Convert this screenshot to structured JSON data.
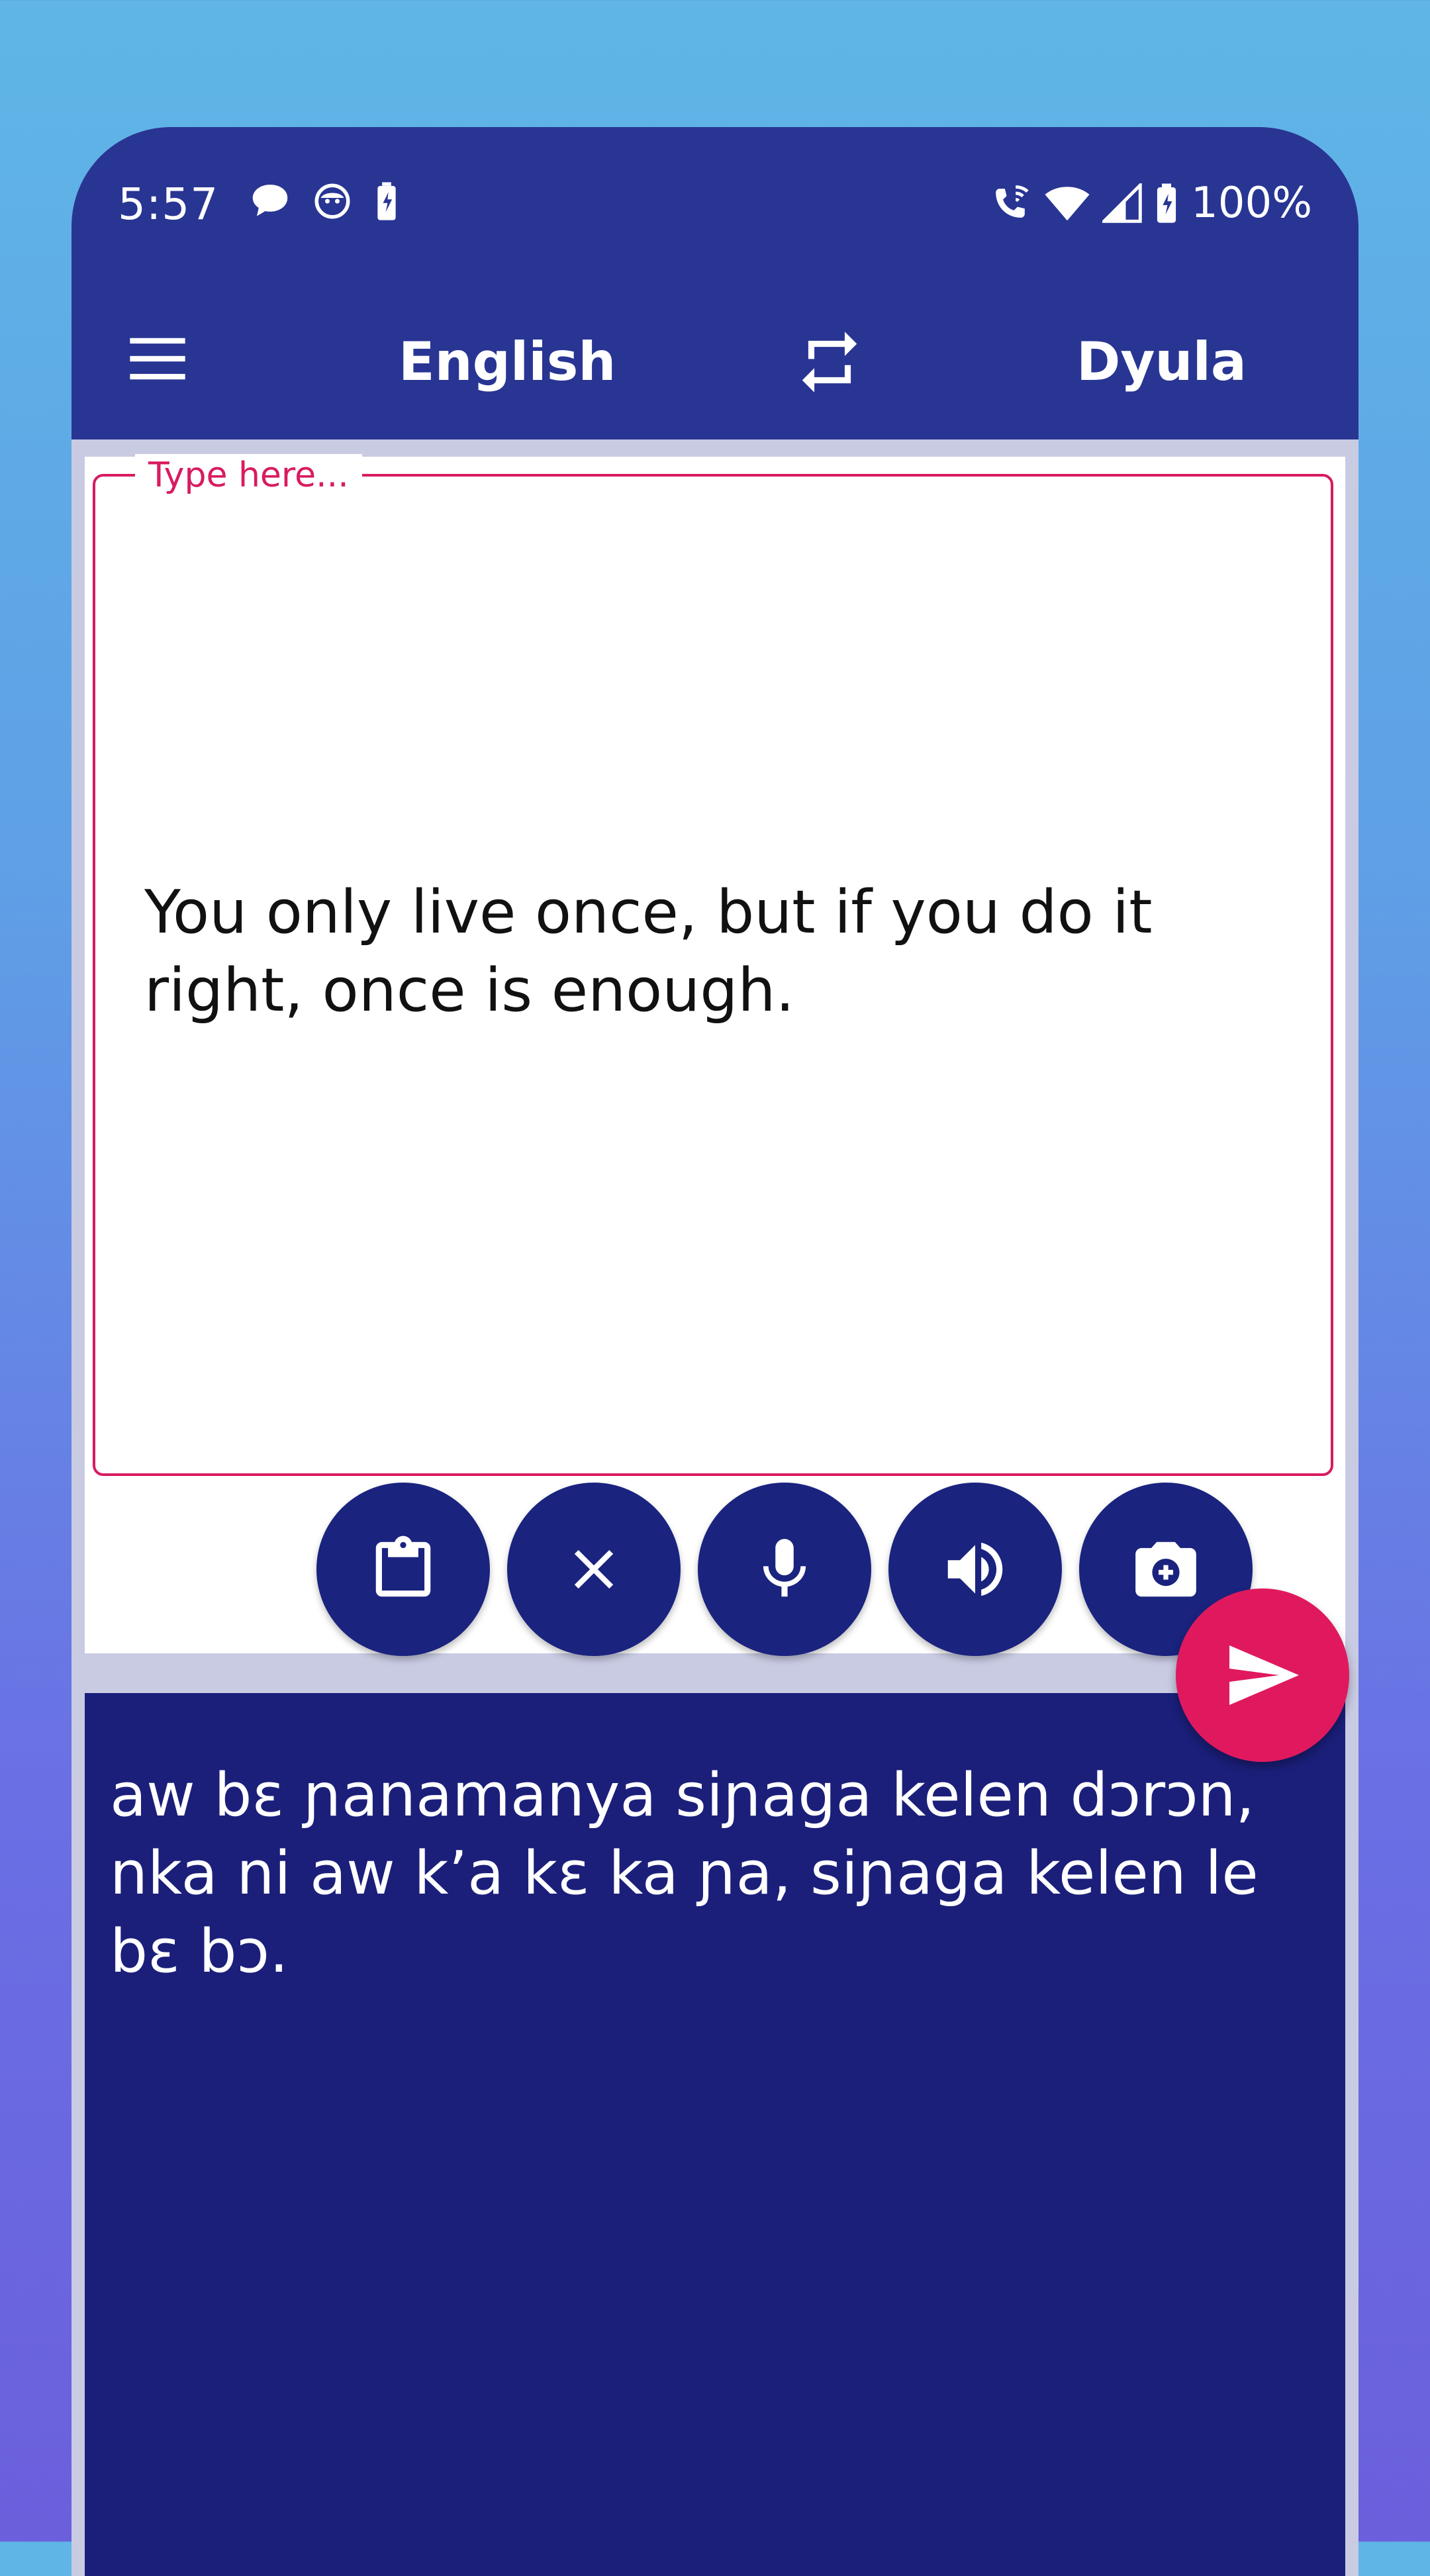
{
  "status_bar": {
    "time": "5:57",
    "battery": "100%",
    "left_icons": [
      "chat-bubble-icon",
      "messenger-icon",
      "battery-saver-icon"
    ],
    "right_icons": [
      "wifi-calling-icon",
      "wifi-icon",
      "signal-icon",
      "battery-icon"
    ]
  },
  "app_bar": {
    "source_language": "English",
    "target_language": "Dyula",
    "menu_icon": "hamburger-menu-icon",
    "swap_icon": "swap-icon"
  },
  "input": {
    "placeholder": "Type here...",
    "value": "You only live once, but if you do it right, once is enough."
  },
  "actions": [
    {
      "name": "paste-button",
      "icon": "clipboard-icon"
    },
    {
      "name": "clear-button",
      "icon": "close-icon"
    },
    {
      "name": "voice-input-button",
      "icon": "microphone-icon"
    },
    {
      "name": "speak-button",
      "icon": "speaker-icon"
    },
    {
      "name": "camera-button",
      "icon": "camera-icon"
    }
  ],
  "send_icon": "send-icon",
  "output": {
    "text": "aw bɛ ɲanamanya siɲaga kelen dɔrɔn, nka ni aw k’a kɛ ka ɲa, siɲaga kelen le bɛ bɔ."
  },
  "colors": {
    "primary": "#283593",
    "primary_dark": "#1a237e",
    "accent": "#e0195f"
  }
}
